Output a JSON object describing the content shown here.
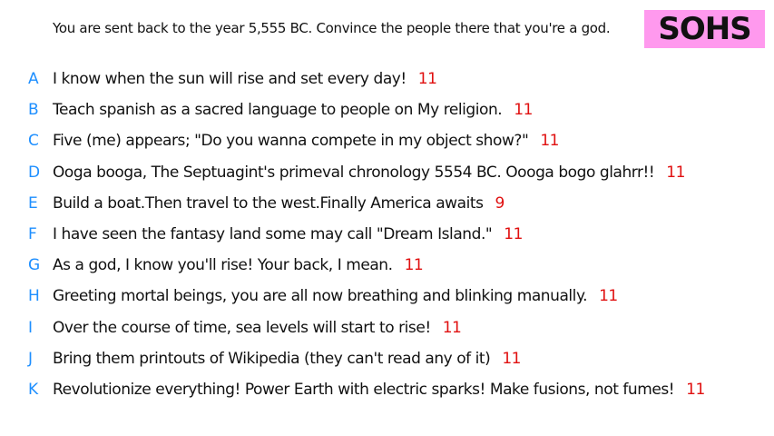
{
  "prompt": "You are sent back to the year 5,555 BC. Convince the people there that you're a god.",
  "badge": {
    "label": "SOHS",
    "color": "#ff99ee"
  },
  "colors": {
    "letter": "#1e8fff",
    "score": "#e01010",
    "text": "#111111"
  },
  "answers": [
    {
      "letter": "A",
      "text": "I know when the sun will rise and set every day!",
      "score": "11"
    },
    {
      "letter": "B",
      "text": "Teach spanish as a sacred language to people on My religion.",
      "score": "11"
    },
    {
      "letter": "C",
      "text": "Five (me) appears; \"Do you wanna compete in my object show?\"",
      "score": "11"
    },
    {
      "letter": "D",
      "text": "Ooga booga, The Septuagint's primeval chronology 5554 BC. Oooga bogo glahrr!!",
      "score": "11"
    },
    {
      "letter": "E",
      "text": "Build a boat.Then travel to the west.Finally America awaits",
      "score": "9"
    },
    {
      "letter": "F",
      "text": "I have seen the fantasy land some may call \"Dream Island.\"",
      "score": "11"
    },
    {
      "letter": "G",
      "text": "As a god, I know you'll rise! Your back, I mean.",
      "score": "11"
    },
    {
      "letter": "H",
      "text": "Greeting mortal beings, you are all now breathing and blinking manually.",
      "score": "11"
    },
    {
      "letter": "I",
      "text": "Over the course of time, sea levels will start to rise!",
      "score": "11"
    },
    {
      "letter": "J",
      "text": "Bring them printouts of Wikipedia (they can't read any of it)",
      "score": "11"
    },
    {
      "letter": "K",
      "text": "Revolutionize everything! Power Earth with electric sparks! Make fusions, not fumes!",
      "score": "11"
    }
  ]
}
